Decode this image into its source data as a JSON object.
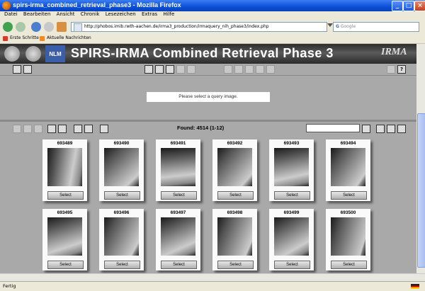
{
  "window": {
    "title": "spirs-irma_combined_retrieval_phase3 - Mozilla Firefox"
  },
  "menu": [
    "Datei",
    "Bearbeiten",
    "Ansicht",
    "Chronik",
    "Lesezeichen",
    "Extras",
    "Hilfe"
  ],
  "browser": {
    "url": "http://phobos.imib.rwth-aachen.de/irma3_production/irmaquery_nih_phase3/index.php",
    "search_placeholder": "Google"
  },
  "bookmarks": [
    "Erste Schritte",
    "Aktuelle Nachrichten"
  ],
  "app": {
    "logo_text": "NLM",
    "banner_title": "SPIRS-IRMA Combined Retrieval Phase 3",
    "brand": "IRMA",
    "query_message": "Please select a query image.",
    "found_text": "Found: 4514 (1-12)",
    "select_label": "Select"
  },
  "results": [
    {
      "id": "693489"
    },
    {
      "id": "693490"
    },
    {
      "id": "693491"
    },
    {
      "id": "693492"
    },
    {
      "id": "693493"
    },
    {
      "id": "693494"
    },
    {
      "id": "693495"
    },
    {
      "id": "693496"
    },
    {
      "id": "693497"
    },
    {
      "id": "693498"
    },
    {
      "id": "693499"
    },
    {
      "id": "693500"
    }
  ],
  "status": {
    "text": "Fertig"
  },
  "colors": {
    "titlebar": "#0a4fd8",
    "banner": "#2c2c2c",
    "panel": "#a9a9a9"
  }
}
